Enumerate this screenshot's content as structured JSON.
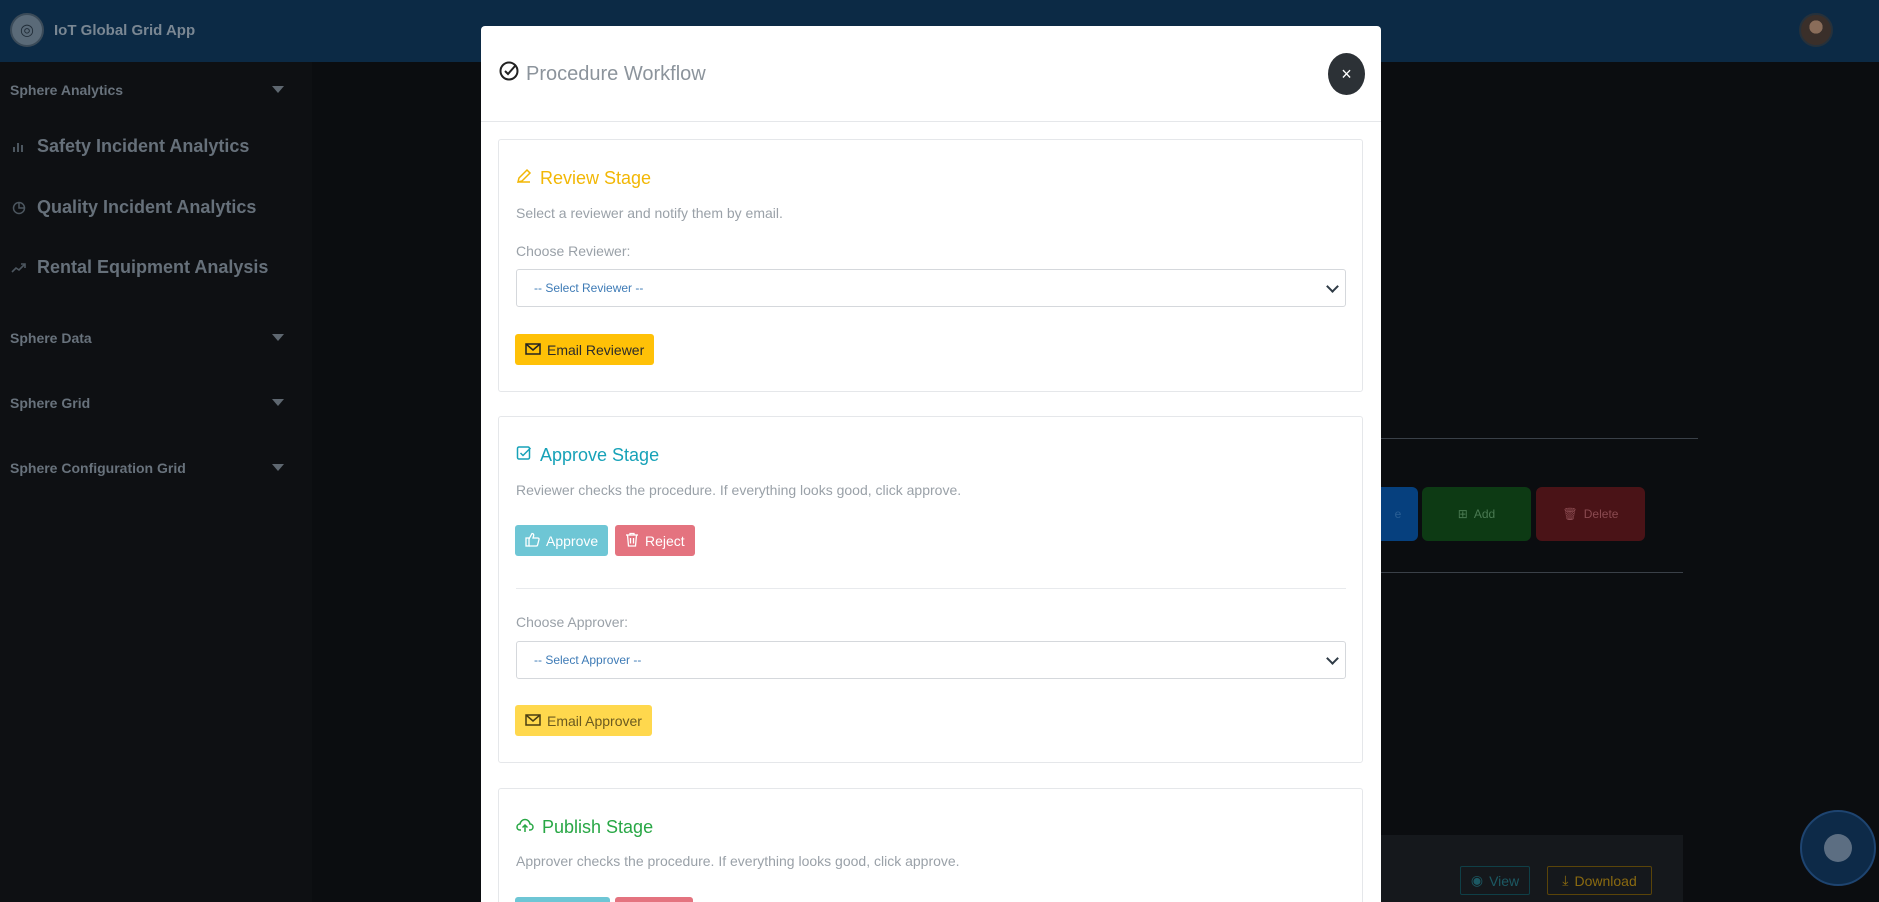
{
  "app": {
    "title": "IoT Global Grid App"
  },
  "sidebar": {
    "sections": [
      {
        "label": "Sphere Analytics"
      },
      {
        "label": "Sphere Data"
      },
      {
        "label": "Sphere Grid"
      },
      {
        "label": "Sphere Configuration Grid"
      }
    ],
    "items": [
      {
        "label": "Safety Incident Analytics",
        "icon": "bar-chart-icon"
      },
      {
        "label": "Quality Incident Analytics",
        "icon": "pie-chart-icon"
      },
      {
        "label": "Rental Equipment Analysis",
        "icon": "trend-icon"
      }
    ]
  },
  "background": {
    "partial_button": "e",
    "add_label": "Add",
    "delete_label": "Delete",
    "view_label": "View",
    "download_label": "Download"
  },
  "modal": {
    "title": "Procedure Workflow",
    "close": "×",
    "review": {
      "title": "Review Stage",
      "desc": "Select a reviewer and notify them by email.",
      "label": "Choose Reviewer:",
      "select_value": "-- Select Reviewer --",
      "email_button": "Email Reviewer"
    },
    "approve": {
      "title": "Approve Stage",
      "desc": "Reviewer checks the procedure. If everything looks good, click approve.",
      "approve_button": "Approve",
      "reject_button": "Reject",
      "label": "Choose Approver:",
      "select_value": "-- Select Approver --",
      "email_button": "Email Approver"
    },
    "publish": {
      "title": "Publish Stage",
      "desc": "Approver checks the procedure. If everything looks good, click approve."
    }
  },
  "colors": {
    "review": "#f2b705",
    "approve": "#17a2b8",
    "publish": "#28a745",
    "approve_btn": "#6ec6d5",
    "reject_btn": "#e4737f",
    "email_reviewer_btn": "#ffc107",
    "email_approver_btn": "#ffd84d"
  }
}
